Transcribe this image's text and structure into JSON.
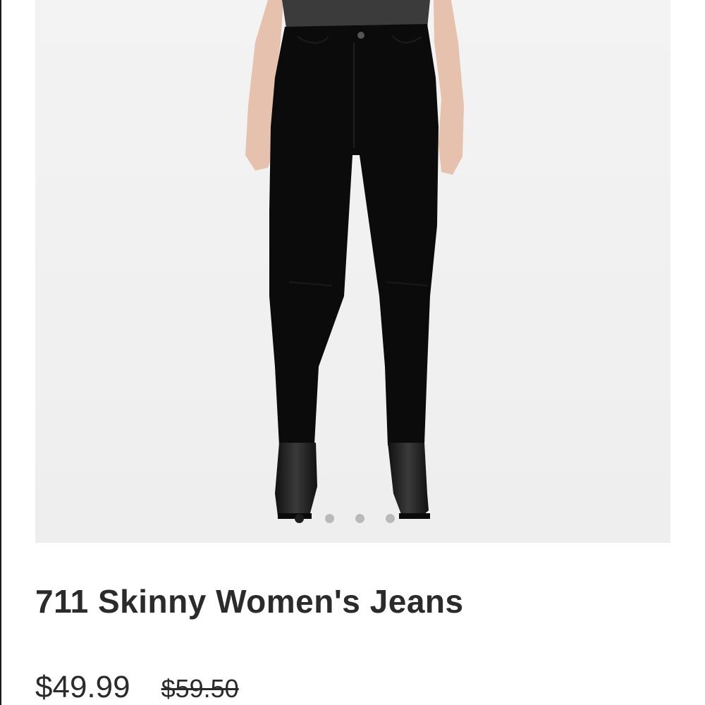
{
  "product": {
    "image": {
      "alt": "Model wearing black skinny jeans and black ankle boots",
      "background_color": "#f1f1f1"
    },
    "carousel": {
      "total_slides": 4,
      "active_slide": 1
    },
    "title": "711 Skinny Women's Jeans",
    "price": {
      "current": "$49.99",
      "original": "$59.50"
    }
  }
}
